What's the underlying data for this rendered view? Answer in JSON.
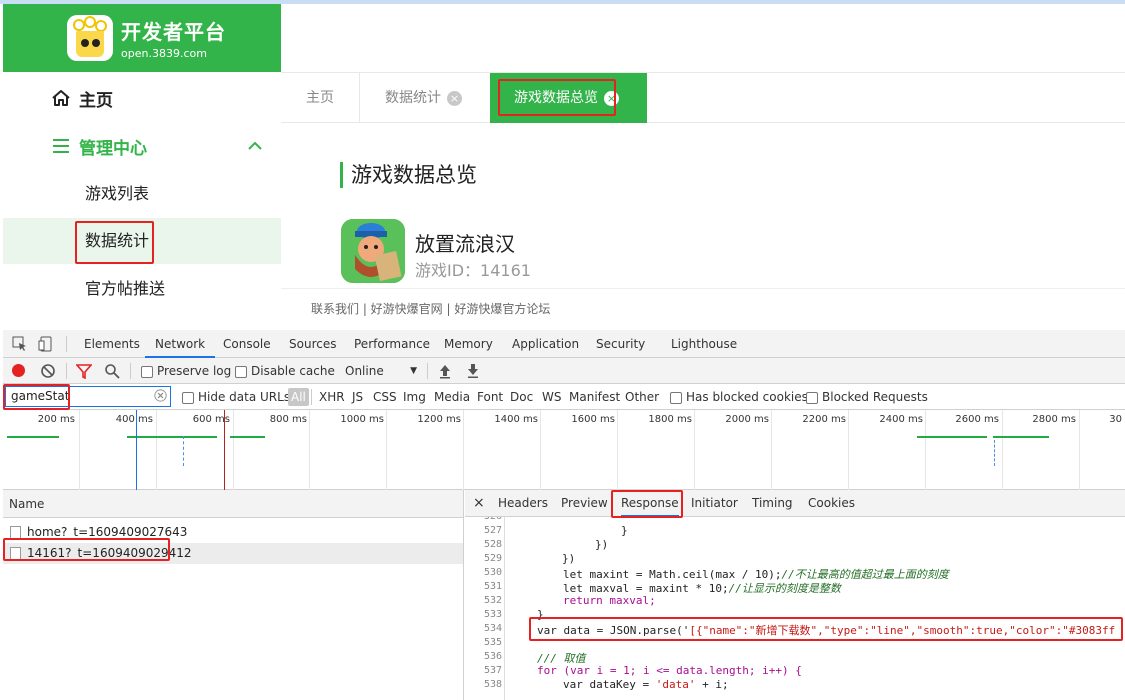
{
  "brand": {
    "title": "开发者平台",
    "subtitle": "open.3839.com"
  },
  "sidebar": {
    "home": "主页",
    "management": "管理中心",
    "items": [
      {
        "label": "游戏列表"
      },
      {
        "label": "数据统计"
      },
      {
        "label": "官方帖推送"
      }
    ]
  },
  "tabs": [
    {
      "label": "主页"
    },
    {
      "label": "数据统计",
      "close": "×"
    },
    {
      "label": "游戏数据总览",
      "close": "×"
    }
  ],
  "main": {
    "title": "游戏数据总览",
    "game_name": "放置流浪汉",
    "game_id": "游戏ID：14161",
    "footer": "联系我们 | 好游快爆官网 | 好游快爆官方论坛"
  },
  "devtools": {
    "tabs": [
      "Elements",
      "Network",
      "Console",
      "Sources",
      "Performance",
      "Memory",
      "Application",
      "Security",
      "Lighthouse"
    ],
    "toolbar": {
      "preserve_log": "Preserve log",
      "disable_cache": "Disable cache",
      "throttle": "Online"
    },
    "filter": {
      "value": "gameStat",
      "hide_data_urls": "Hide data URLs",
      "types": [
        "All",
        "XHR",
        "JS",
        "CSS",
        "Img",
        "Media",
        "Font",
        "Doc",
        "WS",
        "Manifest",
        "Other"
      ],
      "has_blocked": "Has blocked cookies",
      "blocked_requests": "Blocked Requests"
    },
    "timeline": [
      "200 ms",
      "400 ms",
      "600 ms",
      "800 ms",
      "1000 ms",
      "1200 ms",
      "1400 ms",
      "1600 ms",
      "1800 ms",
      "2000 ms",
      "2200 ms",
      "2400 ms",
      "2600 ms",
      "2800 ms",
      "30"
    ],
    "requests": {
      "header": "Name",
      "rows": [
        "home?_t=1609409027643",
        "14161?_t=1609409029412"
      ]
    },
    "detail_tabs": [
      "Headers",
      "Preview",
      "Response",
      "Initiator",
      "Timing",
      "Cookies"
    ],
    "close": "×",
    "code": {
      "line_numbers": [
        "526",
        "527",
        "528",
        "529",
        "530",
        "531",
        "532",
        "533",
        "534",
        "535",
        "536",
        "537",
        "538"
      ],
      "l527": "}",
      "l528": "})",
      "l529": "})",
      "l530a": "let maxint = Math.ceil(max / 10);",
      "l530b": "//不让最高的值超过最上面的刻度",
      "l531a": "let maxval = maxint * 10;",
      "l531b": "//让显示的刻度是整数",
      "l532": "return maxval;",
      "l533": "}",
      "l534a": "var data = JSON.parse('",
      "l534b": "[{\"name\":\"新增下载数\",\"type\":\"line\",\"smooth\":true,\"color\":\"#3083ff",
      "l536": "/// 取值",
      "l537": "for (var i = 1; i <= data.length; i++) {",
      "l538a": "var dataKey = ",
      "l538b": "'data'",
      "l538c": " + i;"
    }
  }
}
